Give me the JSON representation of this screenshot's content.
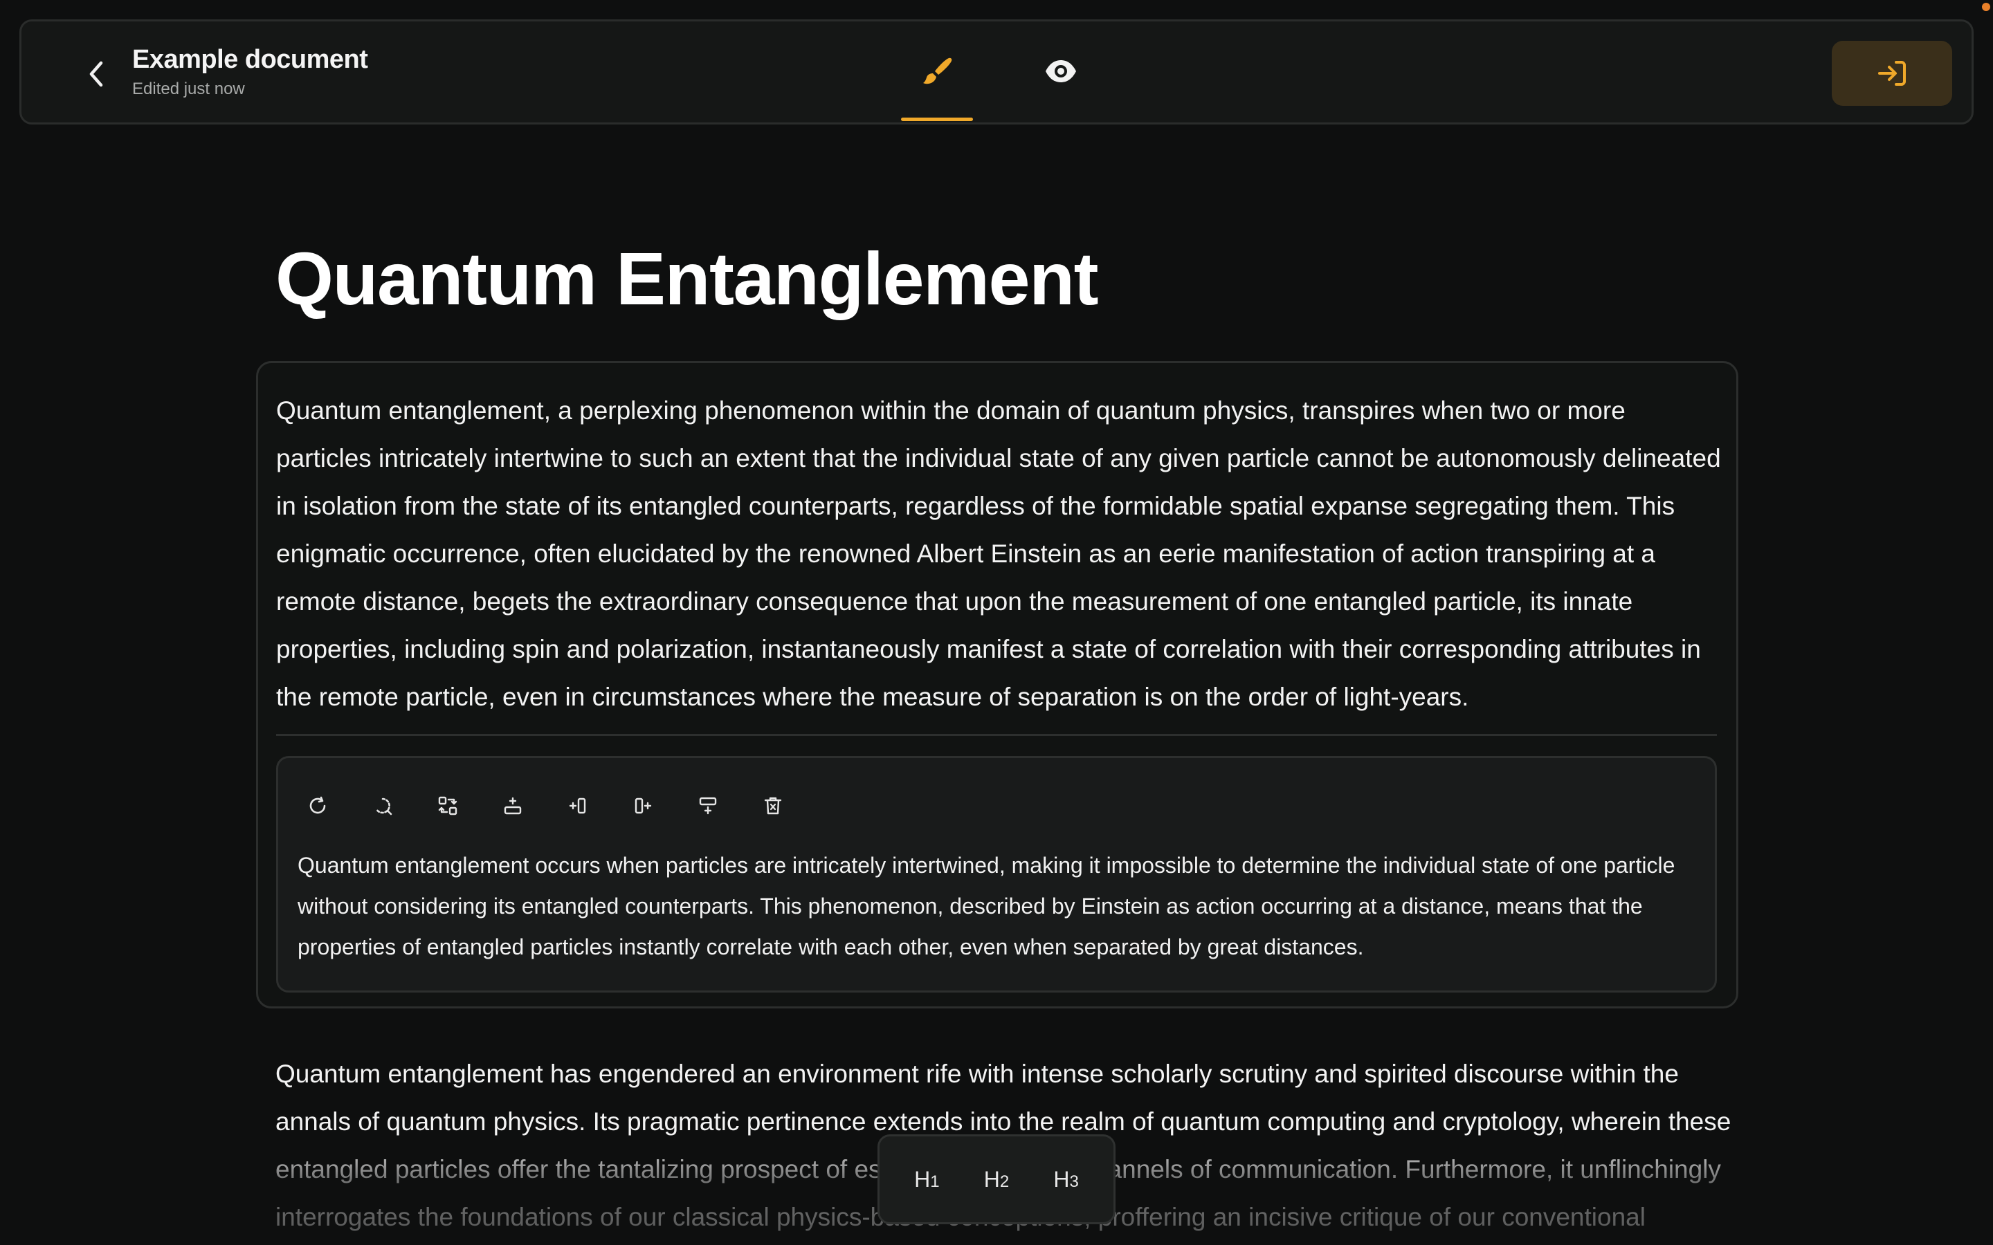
{
  "header": {
    "title": "Example document",
    "subtitle": "Edited just now",
    "tabs": [
      {
        "id": "edit",
        "icon": "brush-icon",
        "active": true
      },
      {
        "id": "preview",
        "icon": "eye-icon",
        "active": false
      }
    ],
    "publish_icon": "sign-in-icon",
    "accent_color": "#f0a92a"
  },
  "page": {
    "title": "Quantum Entanglement"
  },
  "block": {
    "text": "Quantum entanglement, a perplexing phenomenon within the domain of quantum physics, transpires when two or more particles intricately intertwine to such an extent that the individual state of any given particle cannot be autonomously delineated in isolation from the state of its entangled counterparts, regardless of the formidable spatial expanse segregating them. This enigmatic occurrence, often elucidated by the renowned Albert Einstein as an eerie manifestation of action transpiring at a remote distance, begets the extraordinary consequence that upon the measurement of one entangled particle, its innate properties, including spin and polarization, instantaneously manifest a state of correlation with their corresponding attributes in the remote particle, even in circumstances where the measure of separation is on the order of light-years.",
    "suggestion": {
      "tools": [
        "refresh-icon",
        "rewrite-icon",
        "replace-icon",
        "insert-above-icon",
        "insert-before-icon",
        "insert-after-icon",
        "insert-below-icon",
        "delete-icon"
      ],
      "text": "Quantum entanglement occurs when particles are intricately intertwined, making it impossible to determine the individual state of one particle without considering its entangled counterparts. This phenomenon, described by Einstein as action occurring at a distance, means that the properties of entangled particles instantly correlate with each other, even when separated by great distances."
    }
  },
  "paragraph2": {
    "text": "Quantum entanglement has engendered an environment rife with intense scholarly scrutiny and spirited discourse within the annals of quantum physics. Its pragmatic pertinence extends into the realm of quantum computing and cryptology, wherein these entangled particles offer the tantalizing prospect of establishing secure channels of communication. Furthermore, it unflinchingly interrogates the foundations of our classical physics-based conceptions, proffering an incisive critique of our conventional"
  },
  "heading_menu": {
    "h1": "H",
    "h1_num": "1",
    "h2": "H",
    "h2_num": "2",
    "h3": "H",
    "h3_num": "3"
  }
}
